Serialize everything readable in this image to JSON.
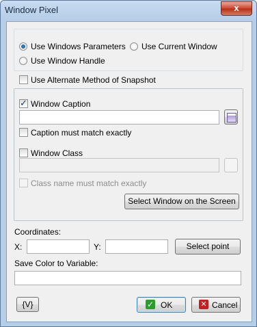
{
  "window": {
    "title": "Window Pixel",
    "close_label": "x"
  },
  "mode": {
    "use_windows_parameters": "Use Windows Parameters",
    "use_current_window": "Use Current Window",
    "use_window_handle": "Use Window Handle",
    "selected": "use_windows_parameters"
  },
  "alternate_method_label": "Use Alternate Method of Snapshot",
  "window_group": {
    "caption_label": "Window Caption",
    "caption_value": "",
    "caption_match_label": "Caption must match exactly",
    "class_label": "Window Class",
    "class_value": "",
    "class_match_label": "Class name must match exactly",
    "select_window_label": "Select Window on the Screen"
  },
  "coordinates": {
    "label": "Coordinates:",
    "x_label": "X:",
    "x_value": "",
    "y_label": "Y:",
    "y_value": "",
    "select_point_label": "Select point"
  },
  "save_color": {
    "label": "Save Color to Variable:",
    "value": ""
  },
  "footer": {
    "variable_button_label": "{V}",
    "ok_label": "OK",
    "cancel_label": "Cancel"
  },
  "colors": {
    "ok_icon": "#2c9c2c",
    "cancel_icon": "#c41e1e"
  }
}
